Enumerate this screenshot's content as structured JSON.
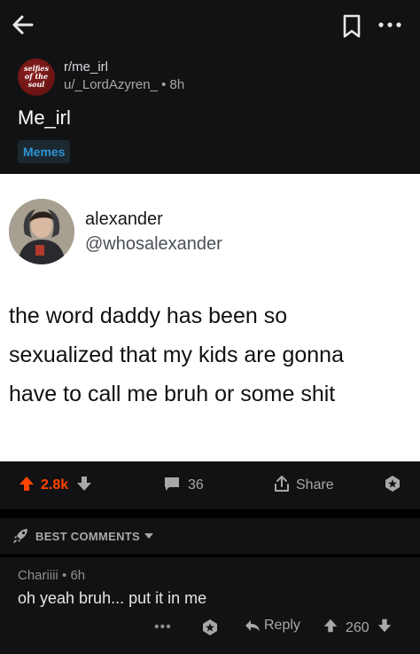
{
  "topbar": {
    "back_icon": "arrow-left-icon",
    "bookmark_icon": "bookmark-icon",
    "more_icon": "more-horizontal-icon"
  },
  "post": {
    "subreddit_logo_lines": [
      "selfies",
      "of the",
      "soul"
    ],
    "subreddit": "r/me_irl",
    "author": "u/_LordAzyren_",
    "separator": "•",
    "age": "8h",
    "title": "Me_irl",
    "flair": "Memes"
  },
  "tweet": {
    "name": "alexander",
    "handle": "@whosalexander",
    "lines": [
      "the word daddy has been so",
      "sexualized that my kids are gonna",
      "have to call me bruh or some shit"
    ]
  },
  "actions": {
    "upvotes": "2.8k",
    "comments": "36",
    "share_label": "Share",
    "accent": "#ff4500"
  },
  "comments_header": {
    "sort_label": "BEST COMMENTS"
  },
  "comment": {
    "author": "Chariiii",
    "separator": "•",
    "age": "6h",
    "body": "oh yeah bruh... put it in me",
    "more": "•••",
    "reply_label": "Reply",
    "score": "260"
  }
}
